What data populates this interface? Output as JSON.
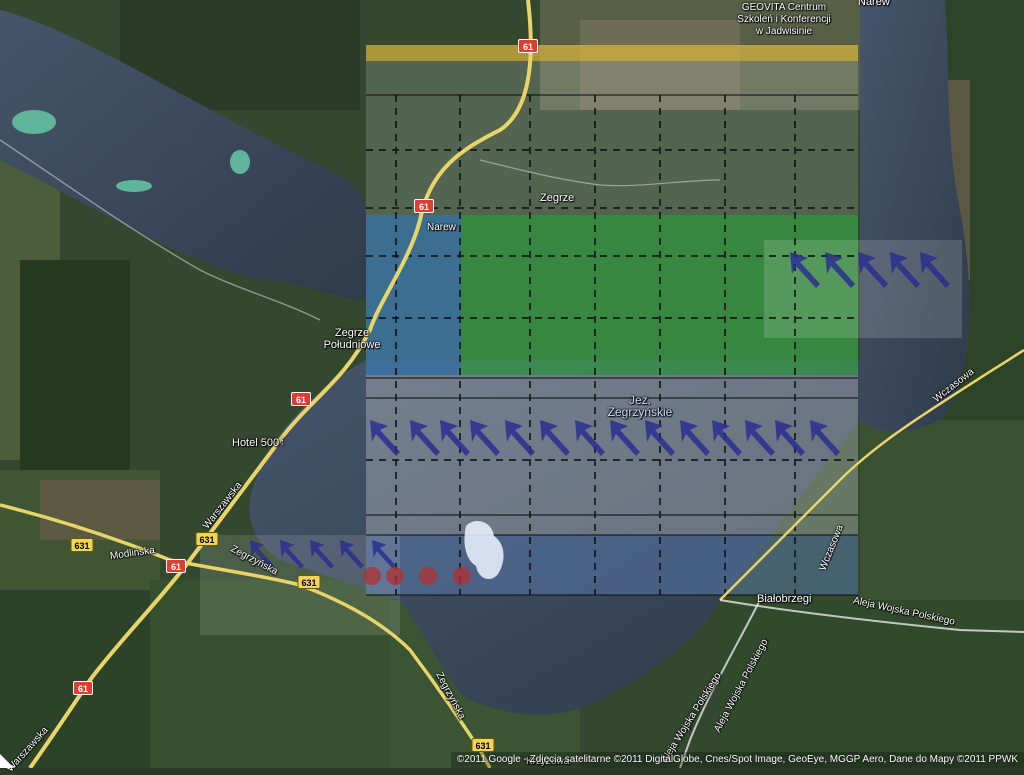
{
  "map": {
    "title": "",
    "places": {
      "geovita": "GEOVITA Centrum\nSzkoleń i Konferencji\nw Jadwisinie",
      "narew_top": "Narew",
      "zegrze": "Zegrze",
      "narew": "Narew",
      "zegrze_poludniowe_1": "Zegrze",
      "zegrze_poludniowe_2": "Południowe",
      "hotel": "Hotel 500",
      "lake_1": "Jez.",
      "lake_2": "Zegrzyńskie",
      "warszawska_1": "Warszawska",
      "warszawska_2": "Warszawska",
      "modlinska": "Modlińska",
      "zegrzynska_1": "Zegrzyńska",
      "zegrzynska_2": "Zegrzyńska",
      "bialobrzegi": "Białobrzegi",
      "wczasowa_1": "Wczasowa",
      "wczasowa_2": "Wczasowa",
      "aleja_wojska_polskiego_1": "Aleja Wojska Polskiego",
      "aleja_wojska_polskiego_2": "Aleja Wojska Polskiego",
      "aleja_wojska_polskiego_3": "Aleja Wojska Polskiego",
      "krzyzowa": "Krzyżowa"
    },
    "shields": {
      "r61_top": "61",
      "r61_mid": "61",
      "r61_lower": "61",
      "r61_bottom_left": "61",
      "r61_far_bottom": "61",
      "r631_left": "631",
      "r631_mid": "631",
      "r631_right": "631",
      "r631_bottom": "631"
    },
    "attribution": "©2011 Google - Zdjęcia satelitarne ©2011 DigitalGlobe, Cnes/Spot Image, GeoEye, MGGP Aero, Dane do Mapy ©2011 PPWK",
    "colors": {
      "forest": "#2f4a2a",
      "water": "#3c4a5a",
      "road_yellow": "#e8d56a",
      "overlay_green": "#1f9e2a",
      "overlay_blue": "#3f5bd1",
      "wind_arrow": "#2a2f8f",
      "dot_red": "#b23030"
    }
  }
}
